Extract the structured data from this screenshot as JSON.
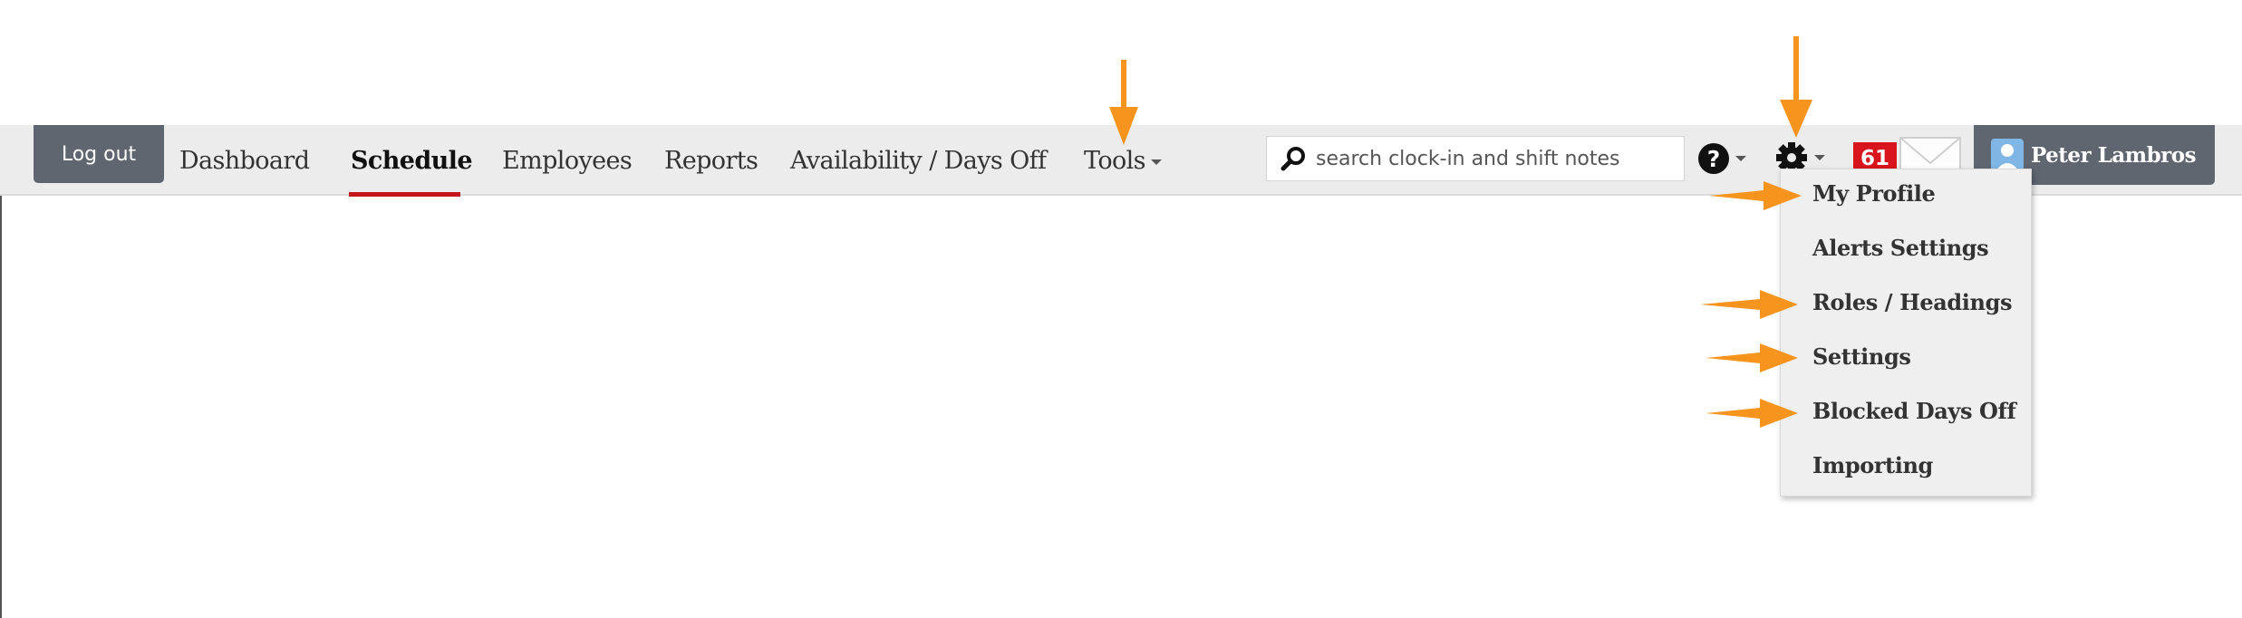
{
  "navbar": {
    "logout_label": "Log out",
    "items": [
      {
        "label": "Dashboard"
      },
      {
        "label": "Schedule",
        "active": true
      },
      {
        "label": "Employees"
      },
      {
        "label": "Reports"
      },
      {
        "label": "Availability / Days Off"
      },
      {
        "label": "Tools"
      }
    ]
  },
  "search": {
    "placeholder": "search clock-in and shift notes",
    "icon": "search-icon"
  },
  "icons": {
    "help": "help-icon",
    "settings": "gear-icon",
    "messages": "envelope-icon"
  },
  "notifications": {
    "count": "61"
  },
  "user": {
    "name": "Peter Lambros",
    "avatar": "avatar"
  },
  "settings_menu": {
    "items": [
      {
        "label": "My Profile"
      },
      {
        "label": "Alerts Settings"
      },
      {
        "label": "Roles / Headings"
      },
      {
        "label": "Settings"
      },
      {
        "label": "Blocked Days Off"
      },
      {
        "label": "Importing"
      }
    ]
  },
  "colors": {
    "accent_arrow": "#f7941d",
    "nav_bg": "#ececec",
    "dark_button": "#5f6670",
    "active_underline": "#c4161c",
    "badge": "#d8151c"
  }
}
